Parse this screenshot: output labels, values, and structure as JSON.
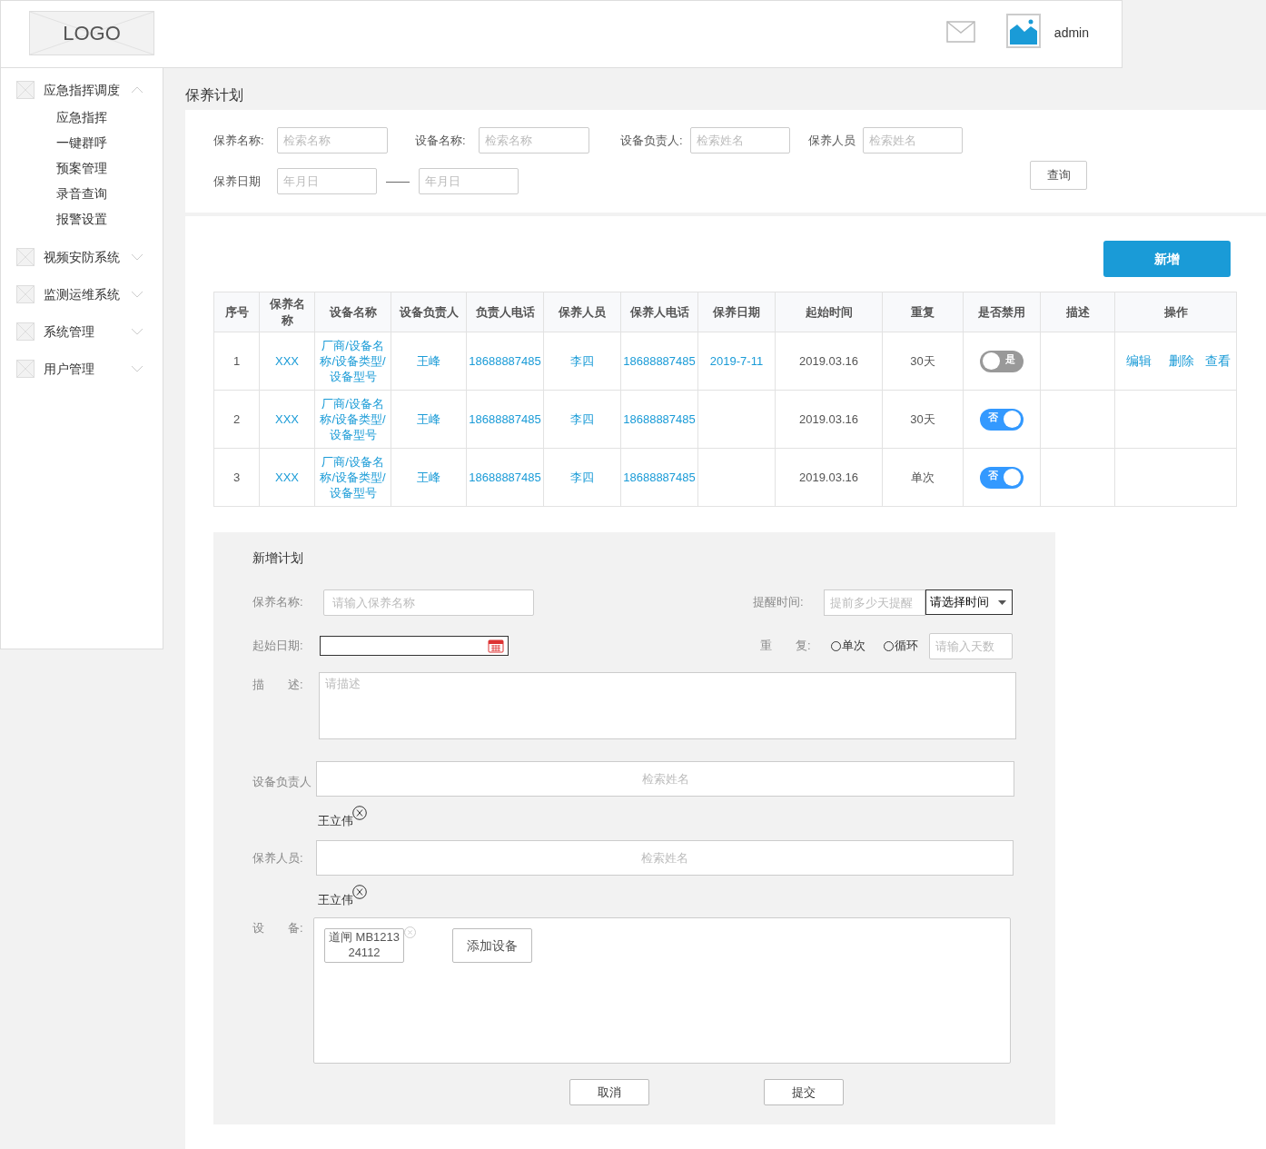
{
  "header": {
    "logo": "LOGO",
    "user": "admin"
  },
  "sidebar": {
    "items": [
      {
        "label": "应急指挥调度",
        "expanded": true,
        "children": [
          {
            "label": "应急指挥"
          },
          {
            "label": "一键群呼"
          },
          {
            "label": "预案管理"
          },
          {
            "label": "录音查询"
          },
          {
            "label": "报警设置"
          }
        ]
      },
      {
        "label": "视频安防系统",
        "expanded": false
      },
      {
        "label": "监测运维系统",
        "expanded": false
      },
      {
        "label": "系统管理",
        "expanded": false
      },
      {
        "label": "用户管理",
        "expanded": false
      }
    ]
  },
  "page_title": "保养计划",
  "filters": [
    {
      "label": "保养名称:",
      "placeholder": "检索名称"
    },
    {
      "label": "设备名称:",
      "placeholder": "检索名称"
    },
    {
      "label": "设备负责人:",
      "placeholder": "检索姓名"
    },
    {
      "label": "保养人员",
      "placeholder": "检索姓名"
    }
  ],
  "date_filter": {
    "label": "保养日期",
    "from_placeholder": "年月日",
    "separator": "——",
    "to_placeholder": "年月日"
  },
  "query_button": "查询",
  "add_button": "新增",
  "table": {
    "columns": [
      "序号",
      "保养名称",
      "设备名称",
      "设备负责人",
      "负责人电话",
      "保养人员",
      "保养人电话",
      "保养日期",
      "起始时间",
      "重复",
      "是否禁用",
      "描述",
      "操作"
    ],
    "rows": [
      {
        "index": "1",
        "plan_name": "XXX",
        "device": "厂商/设备名称/设备类型/设备型号",
        "owner": "王峰",
        "owner_phone": "18688887485",
        "staff": "李四",
        "staff_phone": "18688887485",
        "date": "2019-7-11",
        "start": "2019.03.16",
        "repeat": "30天",
        "disabled": {
          "enabled": false,
          "label": "是"
        },
        "actions": [
          "编辑",
          "删除",
          "查看"
        ]
      },
      {
        "index": "2",
        "plan_name": "XXX",
        "device": "厂商/设备名称/设备类型/设备型号",
        "owner": "王峰",
        "owner_phone": "18688887485",
        "staff": "李四",
        "staff_phone": "18688887485",
        "start": "2019.03.16",
        "repeat": "30天",
        "disabled": {
          "enabled": true,
          "label": "否"
        }
      },
      {
        "index": "3",
        "plan_name": "XXX",
        "device": "厂商/设备名称/设备类型/设备型号",
        "owner": "王峰",
        "owner_phone": "18688887485",
        "staff": "李四",
        "staff_phone": "18688887485",
        "start": "2019.03.16",
        "repeat": "单次",
        "disabled": {
          "enabled": true,
          "label": "否"
        }
      }
    ]
  },
  "form": {
    "title": "新增计划",
    "name": {
      "label": "保养名称:",
      "placeholder": "请输入保养名称"
    },
    "reminder": {
      "label": "提醒时间:",
      "placeholder": "提前多少天提醒",
      "select": "请选择时间"
    },
    "start_date": {
      "label": "起始日期:"
    },
    "repeat": {
      "label": "重　　复:",
      "options": [
        {
          "label": "单次",
          "selected": false
        },
        {
          "label": "循环",
          "selected": false
        }
      ],
      "placeholder": "请输入天数"
    },
    "description": {
      "label": "描　　述:",
      "placeholder": "请描述"
    },
    "owner": {
      "label": "设备负责人",
      "placeholder": "检索姓名",
      "tags": [
        "王立伟"
      ]
    },
    "staff": {
      "label": "保养人员:",
      "placeholder": "检索姓名",
      "tags": [
        "王立伟"
      ]
    },
    "devices": {
      "label": "设　　备:",
      "items": [
        "道闸 MB121324112"
      ],
      "add_button": "添加设备"
    },
    "buttons": [
      "取消",
      "提交"
    ]
  }
}
